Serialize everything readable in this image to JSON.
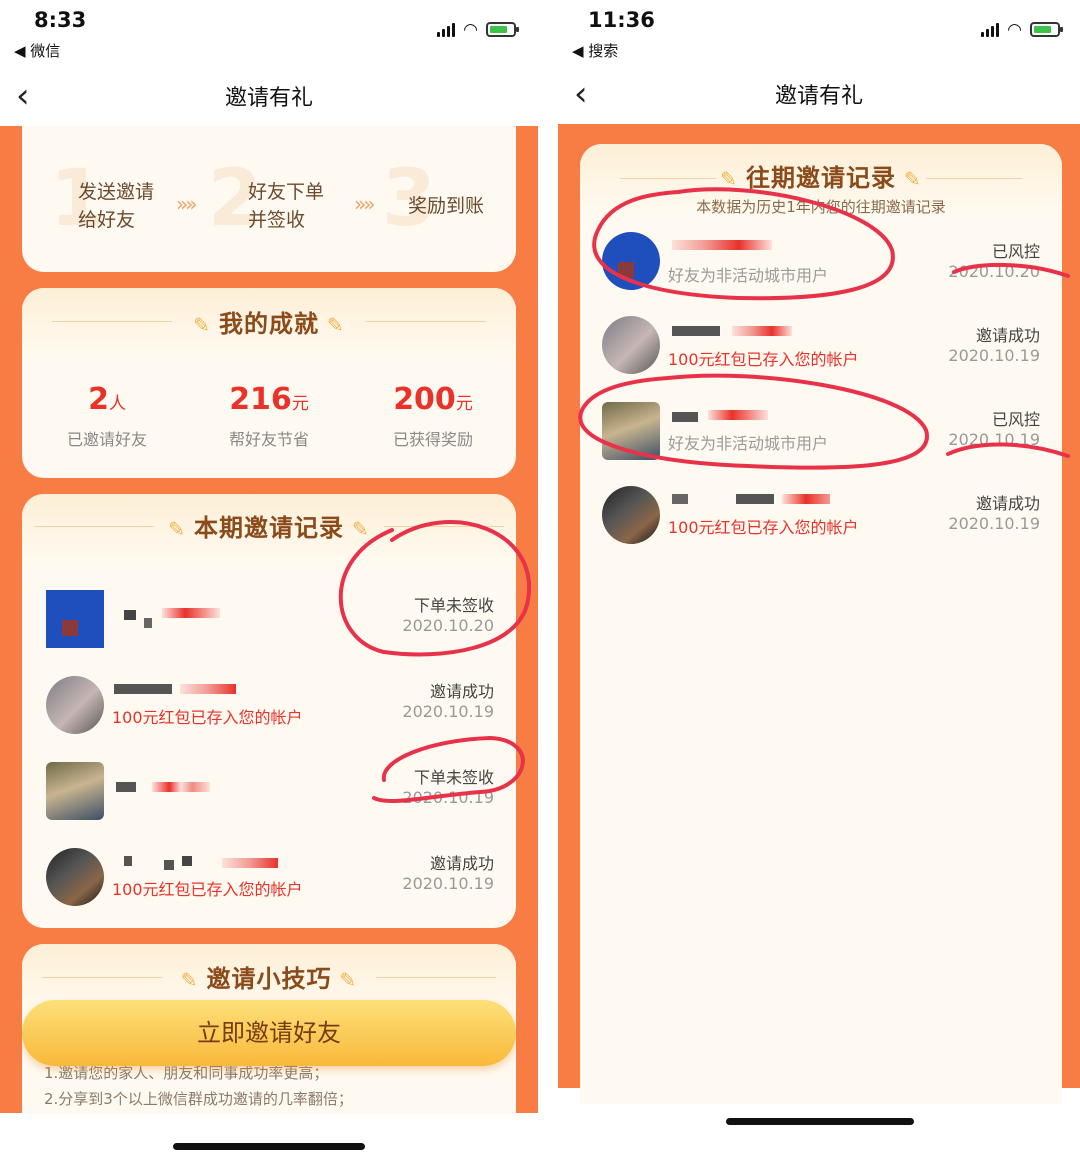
{
  "left": {
    "status": {
      "time": "8:33",
      "back_app": "◀ 微信"
    },
    "nav": {
      "title": "邀请有礼"
    },
    "steps": [
      {
        "num": "1",
        "text": "发送邀请\n给好友"
      },
      {
        "num": "2",
        "text": "好友下单\n并签收"
      },
      {
        "num": "3",
        "text": "奖励到账"
      }
    ],
    "step_arrow": "»»",
    "achievements": {
      "title": "我的成就",
      "items": [
        {
          "value": "2",
          "unit": "人",
          "label": "已邀请好友"
        },
        {
          "value": "216",
          "unit": "元",
          "label": "帮好友节省"
        },
        {
          "value": "200",
          "unit": "元",
          "label": "已获得奖励"
        }
      ]
    },
    "records": {
      "title": "本期邀请记录",
      "items": [
        {
          "avatar": "blue",
          "sub": "",
          "sub_color": "red",
          "status": "下单未签收",
          "date": "2020.10.20"
        },
        {
          "avatar": "gray",
          "sub": "100元红包已存入您的帐户",
          "sub_color": "red",
          "status": "邀请成功",
          "date": "2020.10.19"
        },
        {
          "avatar": "mix",
          "sub": "",
          "sub_color": "red",
          "status": "下单未签收",
          "date": "2020.10.19"
        },
        {
          "avatar": "dark",
          "sub": "100元红包已存入您的帐户",
          "sub_color": "red",
          "status": "邀请成功",
          "date": "2020.10.19"
        }
      ]
    },
    "tips": {
      "title": "邀请小技巧",
      "button": "立即邀请好友",
      "lines": [
        "1.邀请您的家人、朋友和同事成功率更高；",
        "2.分享到3个以上微信群成功邀请的几率翻倍；"
      ]
    }
  },
  "right": {
    "status": {
      "time": "11:36",
      "back_app": "◀ 搜索"
    },
    "nav": {
      "title": "邀请有礼"
    },
    "history": {
      "title": "往期邀请记录",
      "subtitle": "本数据为历史1年内您的往期邀请记录",
      "items": [
        {
          "avatar": "blue",
          "sub": "好友为非活动城市用户",
          "sub_color": "gray",
          "status": "已风控",
          "date": "2020.10.20"
        },
        {
          "avatar": "gray",
          "sub": "100元红包已存入您的帐户",
          "sub_color": "red",
          "status": "邀请成功",
          "date": "2020.10.19"
        },
        {
          "avatar": "mix",
          "sub": "好友为非活动城市用户",
          "sub_color": "gray",
          "status": "已风控",
          "date": "2020.10.19"
        },
        {
          "avatar": "dark",
          "sub": "100元红包已存入您的帐户",
          "sub_color": "red",
          "status": "邀请成功",
          "date": "2020.10.19"
        }
      ]
    }
  },
  "colors": {
    "orange_bg": "#f77d45",
    "card_bg": "#fffaf1",
    "accent_red": "#e8322a",
    "title_brown": "#8a4a1a",
    "annotation_red": "#e8324a"
  },
  "icons": [
    "back-chevron-icon",
    "signal-icon",
    "wifi-icon",
    "battery-icon",
    "leaf-icon",
    "double-chevron-icon"
  ]
}
